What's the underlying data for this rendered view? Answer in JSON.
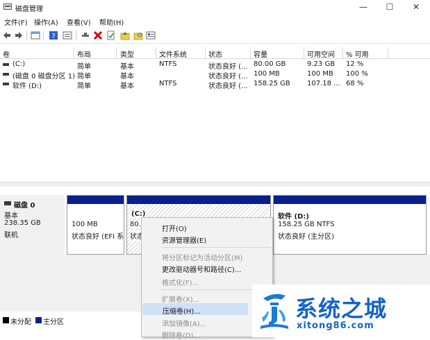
{
  "window": {
    "title": "磁盘管理",
    "minimize_glyph": "—",
    "maximize_glyph": "☐",
    "close_glyph": "✕"
  },
  "menubar": {
    "items": [
      "文件(F)",
      "操作(A)",
      "查看(V)",
      "帮助(H)"
    ]
  },
  "toolbar": {
    "icons": [
      "back-arrow-icon",
      "forward-arrow-icon",
      "list-view-icon",
      "help-icon",
      "properties-icon",
      "connect-icon",
      "delete-icon",
      "check-icon",
      "folder-up-icon",
      "folder-search-icon",
      "details-icon"
    ]
  },
  "volume_table": {
    "columns": [
      "卷",
      "布局",
      "类型",
      "文件系统",
      "状态",
      "容量",
      "可用空间",
      "% 可用"
    ],
    "rows": [
      {
        "volume": "(C:)",
        "layout": "简单",
        "type": "基本",
        "fs": "NTFS",
        "status": "状态良好 (...",
        "capacity": "80.00 GB",
        "free": "9.23 GB",
        "pct": "12 %"
      },
      {
        "volume": "(磁盘 0 磁盘分区 1)",
        "layout": "简单",
        "type": "基本",
        "fs": "",
        "status": "状态良好 (...",
        "capacity": "100 MB",
        "free": "100 MB",
        "pct": "100 %"
      },
      {
        "volume": "软件 (D:)",
        "layout": "简单",
        "type": "基本",
        "fs": "NTFS",
        "status": "状态良好 (...",
        "capacity": "158.25 GB",
        "free": "107.18 ...",
        "pct": "68 %"
      }
    ]
  },
  "disk0": {
    "name": "磁盘 0",
    "type": "基本",
    "size": "238.35 GB",
    "state": "联机",
    "partitions": [
      {
        "line1": "",
        "line2": "100 MB",
        "line3": "状态良好 (EFI 系"
      },
      {
        "line1": "(C:)",
        "line2": "80.0",
        "line3": "状态"
      },
      {
        "line1": "软件  (D:)",
        "line2": "158.25 GB NTFS",
        "line3": "状态良好 (主分区)"
      }
    ]
  },
  "legend": {
    "unallocated": "未分配",
    "primary": "主分区",
    "unallocated_color": "#000000",
    "primary_color": "#0b1f8a"
  },
  "context_menu": {
    "items": [
      {
        "label": "打开(O)",
        "enabled": true
      },
      {
        "label": "资源管理器(E)",
        "enabled": true
      },
      {
        "label": "将分区标记为活动分区(M)",
        "enabled": false
      },
      {
        "label": "更改驱动器号和路径(C)...",
        "enabled": true
      },
      {
        "label": "格式化(F)...",
        "enabled": false
      },
      {
        "label": "扩展卷(X)...",
        "enabled": false
      },
      {
        "label": "压缩卷(H)...",
        "enabled": true,
        "highlighted": true
      },
      {
        "label": "添加镜像(A)...",
        "enabled": false
      },
      {
        "label": "删除卷(D)...",
        "enabled": false
      }
    ]
  },
  "watermark": {
    "brand": "系统之城",
    "url": "xitong86.com"
  }
}
